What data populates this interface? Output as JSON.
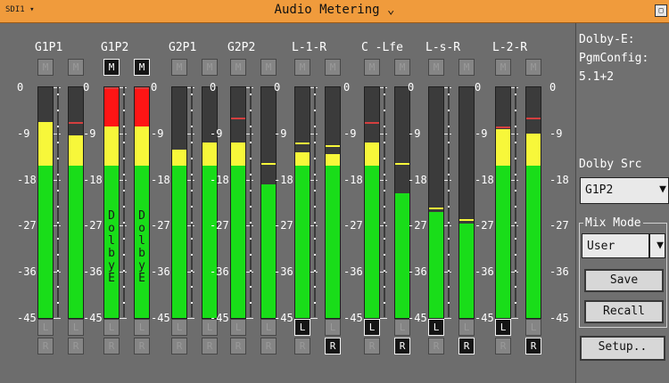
{
  "title": "Audio Metering",
  "title_dropdown_icon": "chevron-down-icon",
  "sdi_label": "SDI1",
  "window_btn": "□",
  "side_info": {
    "line1": "Dolby-E:",
    "line2": "PgmConfig:",
    "line3": "5.1+2",
    "src_label": "Dolby Src",
    "src_value": "G1P2",
    "mix_mode_label": "Mix Mode",
    "mix_mode_value": "User",
    "save_label": "Save",
    "recall_label": "Recall",
    "setup_label": "Setup.."
  },
  "scale_labels": [
    "0",
    "-9",
    "-18",
    "-27",
    "-36",
    "-45"
  ],
  "groups": [
    {
      "label": "G1P1",
      "m": [
        false,
        false
      ],
      "l": [
        false,
        false
      ],
      "r": [
        false,
        false
      ],
      "dolby": false,
      "levels": [
        {
          "green": 0.66,
          "yellow": 0.19,
          "red": 0.0,
          "peak": 0.79
        },
        {
          "green": 0.66,
          "yellow": 0.13,
          "red": 0.0,
          "peak": 0.85
        }
      ]
    },
    {
      "label": "G1P2",
      "m": [
        true,
        true
      ],
      "l": [
        false,
        false
      ],
      "r": [
        false,
        false
      ],
      "dolby": true,
      "levels": [
        {
          "green": 0.66,
          "yellow": 0.17,
          "red": 0.17,
          "peak": 1.0
        },
        {
          "green": 0.66,
          "yellow": 0.17,
          "red": 0.17,
          "peak": 1.0
        }
      ]
    },
    {
      "label": "G2P1",
      "m": [
        false,
        false
      ],
      "l": [
        false,
        false
      ],
      "r": [
        false,
        false
      ],
      "dolby": false,
      "levels": [
        {
          "green": 0.66,
          "yellow": 0.07,
          "red": 0.0,
          "peak": 0.73
        },
        {
          "green": 0.66,
          "yellow": 0.1,
          "red": 0.0,
          "peak": 0.76
        }
      ]
    },
    {
      "label": "G2P2",
      "m": [
        false,
        false
      ],
      "l": [
        false,
        false
      ],
      "r": [
        false,
        false
      ],
      "dolby": false,
      "levels": [
        {
          "green": 0.66,
          "yellow": 0.1,
          "red": 0.0,
          "peak": 0.87
        },
        {
          "green": 0.58,
          "yellow": 0.0,
          "red": 0.0,
          "peak": 0.67
        }
      ]
    },
    {
      "label": "L-1-R",
      "m": [
        false,
        false
      ],
      "l": [
        true,
        false
      ],
      "r": [
        false,
        true
      ],
      "dolby": false,
      "levels": [
        {
          "green": 0.66,
          "yellow": 0.06,
          "red": 0.0,
          "peak": 0.76
        },
        {
          "green": 0.66,
          "yellow": 0.05,
          "red": 0.0,
          "peak": 0.75
        }
      ]
    },
    {
      "label": "C -Lfe",
      "m": [
        false,
        false
      ],
      "l": [
        true,
        false
      ],
      "r": [
        false,
        true
      ],
      "dolby": false,
      "levels": [
        {
          "green": 0.66,
          "yellow": 0.1,
          "red": 0.0,
          "peak": 0.85
        },
        {
          "green": 0.54,
          "yellow": 0.0,
          "red": 0.0,
          "peak": 0.67
        }
      ]
    },
    {
      "label": "L-s-R",
      "m": [
        false,
        false
      ],
      "l": [
        true,
        false
      ],
      "r": [
        false,
        true
      ],
      "dolby": false,
      "levels": [
        {
          "green": 0.46,
          "yellow": 0.0,
          "red": 0.0,
          "peak": 0.48
        },
        {
          "green": 0.41,
          "yellow": 0.0,
          "red": 0.0,
          "peak": 0.43
        }
      ]
    },
    {
      "label": "L-2-R",
      "m": [
        false,
        false
      ],
      "l": [
        true,
        false
      ],
      "r": [
        false,
        true
      ],
      "dolby": false,
      "levels": [
        {
          "green": 0.66,
          "yellow": 0.16,
          "red": 0.0,
          "peak": 0.83
        },
        {
          "green": 0.66,
          "yellow": 0.14,
          "red": 0.0,
          "peak": 0.87
        }
      ]
    }
  ],
  "colors": {
    "green": "#19dd19",
    "yellow": "#f7f73a",
    "red": "#ff1515",
    "peak_red": "#d43f3f",
    "peak_yellow": "#ffffff",
    "orange": "#ff8a2a"
  },
  "dolby_text": "DolbyE"
}
